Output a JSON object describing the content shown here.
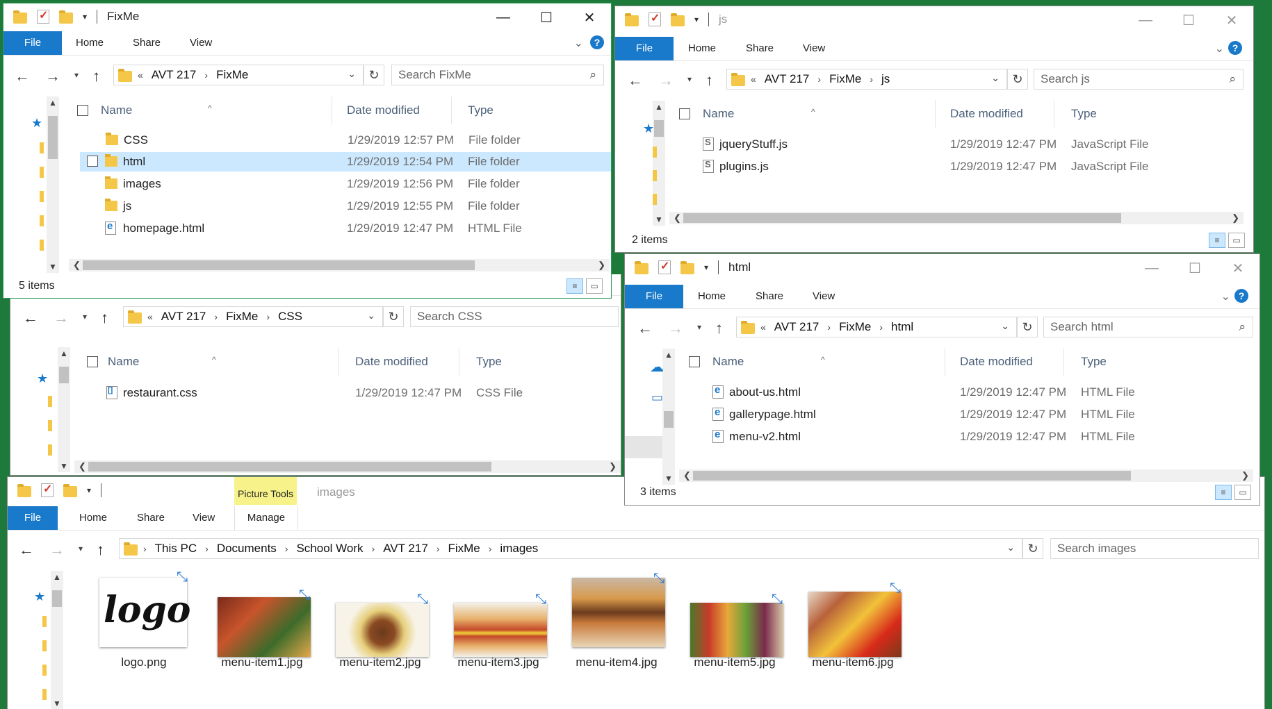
{
  "ribbon": {
    "file": "File",
    "home": "Home",
    "share": "Share",
    "view": "View",
    "manage": "Manage",
    "picture_tools": "Picture Tools",
    "help": "?"
  },
  "columns": {
    "name": "Name",
    "date": "Date modified",
    "type": "Type"
  },
  "fixme": {
    "title": "FixMe",
    "path": [
      "AVT 217",
      "FixMe"
    ],
    "search": "Search FixMe",
    "rows": [
      {
        "name": "CSS",
        "date": "1/29/2019 12:57 PM",
        "type": "File folder",
        "icon": "folder-icon"
      },
      {
        "name": "html",
        "date": "1/29/2019 12:54 PM",
        "type": "File folder",
        "icon": "folder-icon",
        "selected": true
      },
      {
        "name": "images",
        "date": "1/29/2019 12:56 PM",
        "type": "File folder",
        "icon": "folder-icon"
      },
      {
        "name": "js",
        "date": "1/29/2019 12:55 PM",
        "type": "File folder",
        "icon": "folder-icon"
      },
      {
        "name": "homepage.html",
        "date": "1/29/2019 12:47 PM",
        "type": "HTML File",
        "icon": "html-file-icon"
      }
    ],
    "status": "5 items"
  },
  "js": {
    "title": "js",
    "path": [
      "AVT 217",
      "FixMe",
      "js"
    ],
    "search": "Search js",
    "rows": [
      {
        "name": "jqueryStuff.js",
        "date": "1/29/2019 12:47 PM",
        "type": "JavaScript File"
      },
      {
        "name": "plugins.js",
        "date": "1/29/2019 12:47 PM",
        "type": "JavaScript File"
      }
    ],
    "status": "2 items"
  },
  "css": {
    "path": [
      "AVT 217",
      "FixMe",
      "CSS"
    ],
    "search": "Search CSS",
    "rows": [
      {
        "name": "restaurant.css",
        "date": "1/29/2019 12:47 PM",
        "type": "CSS File"
      }
    ]
  },
  "html": {
    "title": "html",
    "path": [
      "AVT 217",
      "FixMe",
      "html"
    ],
    "search": "Search html",
    "rows": [
      {
        "name": "about-us.html",
        "date": "1/29/2019 12:47 PM",
        "type": "HTML File"
      },
      {
        "name": "gallerypage.html",
        "date": "1/29/2019 12:47 PM",
        "type": "HTML File"
      },
      {
        "name": "menu-v2.html",
        "date": "1/29/2019 12:47 PM",
        "type": "HTML File"
      }
    ],
    "status": "3 items"
  },
  "images": {
    "title": "images",
    "path": [
      "This PC",
      "Documents",
      "School Work",
      "AVT 217",
      "FixMe",
      "images"
    ],
    "search": "Search images",
    "files": [
      "logo.png",
      "menu-item1.jpg",
      "menu-item2.jpg",
      "menu-item3.jpg",
      "menu-item4.jpg",
      "menu-item5.jpg",
      "menu-item6.jpg"
    ]
  },
  "colors": {
    "accent": "#1979ca",
    "selected_row": "#cce8ff",
    "picture_tools": "#f7f38a",
    "desktop": "#1e7a3a"
  }
}
